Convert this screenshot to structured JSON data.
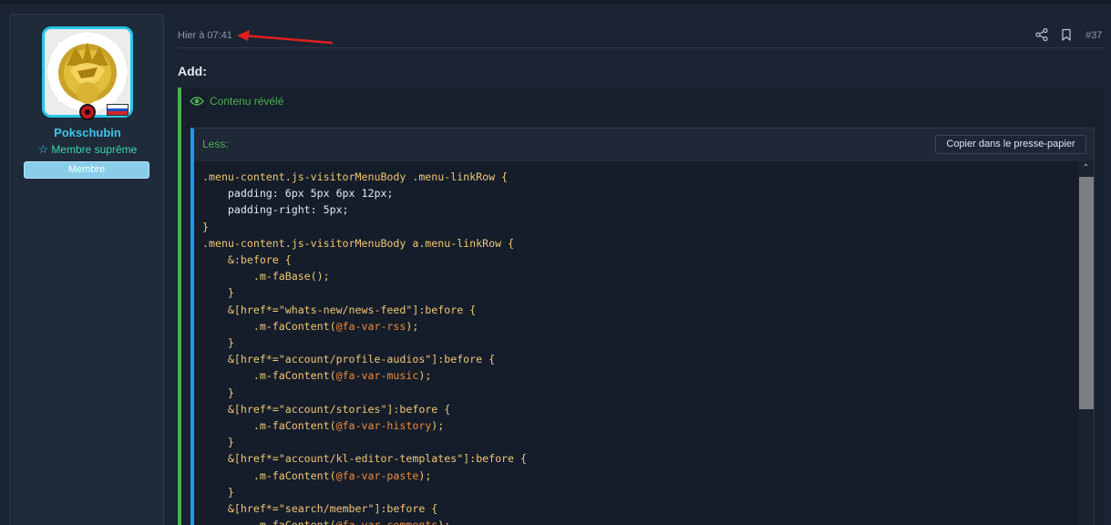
{
  "post": {
    "time": "Hier à 07:41",
    "number": "#37",
    "body_text": "Add:"
  },
  "user": {
    "name": "Pokschubin",
    "title": "Membre suprême",
    "banner": "Membre"
  },
  "reveal": {
    "title": "Contenu révélé"
  },
  "code_block": {
    "language": "Less:",
    "copy_label": "Copier dans le presse-papier",
    "lines": [
      [
        {
          "t": ".menu-content.js-visitorMenuBody .menu-linkRow {",
          "c": "sel"
        }
      ],
      [
        {
          "t": "    padding: 6px 5px 6px 12px;",
          "c": "plain"
        }
      ],
      [
        {
          "t": "    padding-right: 5px;",
          "c": "plain"
        }
      ],
      [
        {
          "t": "}",
          "c": "sel"
        }
      ],
      [
        {
          "t": ".menu-content.js-visitorMenuBody a.menu-linkRow {",
          "c": "sel"
        }
      ],
      [
        {
          "t": "    &:before {",
          "c": "sel"
        }
      ],
      [
        {
          "t": "        .m-faBase();",
          "c": "sel"
        }
      ],
      [
        {
          "t": "    }",
          "c": "sel"
        }
      ],
      [
        {
          "t": "    &[href*=\"whats-new/news-feed\"]:before {",
          "c": "sel"
        }
      ],
      [
        {
          "t": "        .m-faContent(",
          "c": "sel"
        },
        {
          "t": "@fa-var-rss",
          "c": "var"
        },
        {
          "t": ");",
          "c": "sel"
        }
      ],
      [
        {
          "t": "    }",
          "c": "sel"
        }
      ],
      [
        {
          "t": "    &[href*=\"account/profile-audios\"]:before {",
          "c": "sel"
        }
      ],
      [
        {
          "t": "        .m-faContent(",
          "c": "sel"
        },
        {
          "t": "@fa-var-music",
          "c": "var"
        },
        {
          "t": ");",
          "c": "sel"
        }
      ],
      [
        {
          "t": "    }",
          "c": "sel"
        }
      ],
      [
        {
          "t": "    &[href*=\"account/stories\"]:before {",
          "c": "sel"
        }
      ],
      [
        {
          "t": "        .m-faContent(",
          "c": "sel"
        },
        {
          "t": "@fa-var-history",
          "c": "var"
        },
        {
          "t": ");",
          "c": "sel"
        }
      ],
      [
        {
          "t": "    }",
          "c": "sel"
        }
      ],
      [
        {
          "t": "    &[href*=\"account/kl-editor-templates\"]:before {",
          "c": "sel"
        }
      ],
      [
        {
          "t": "        .m-faContent(",
          "c": "sel"
        },
        {
          "t": "@fa-var-paste",
          "c": "var"
        },
        {
          "t": ");",
          "c": "sel"
        }
      ],
      [
        {
          "t": "    }",
          "c": "sel"
        }
      ],
      [
        {
          "t": "    &[href*=\"search/member\"]:before {",
          "c": "sel"
        }
      ],
      [
        {
          "t": "        .m-faContent(",
          "c": "sel"
        },
        {
          "t": "@fa-var-comments",
          "c": "var"
        },
        {
          "t": ");",
          "c": "sel"
        }
      ]
    ]
  },
  "icons": {
    "share": "share-icon",
    "bookmark": "bookmark-icon",
    "eye": "eye-icon",
    "star": "star-icon",
    "arrow": "red-arrow-annotation"
  },
  "colors": {
    "accent_cyan": "#3ec6e6",
    "reveal_green": "#4caf50",
    "code_blue": "#2196f3",
    "selector_yellow": "#f0c674",
    "variable_orange": "#ef8b3a",
    "annotation_red": "#e0201c"
  }
}
